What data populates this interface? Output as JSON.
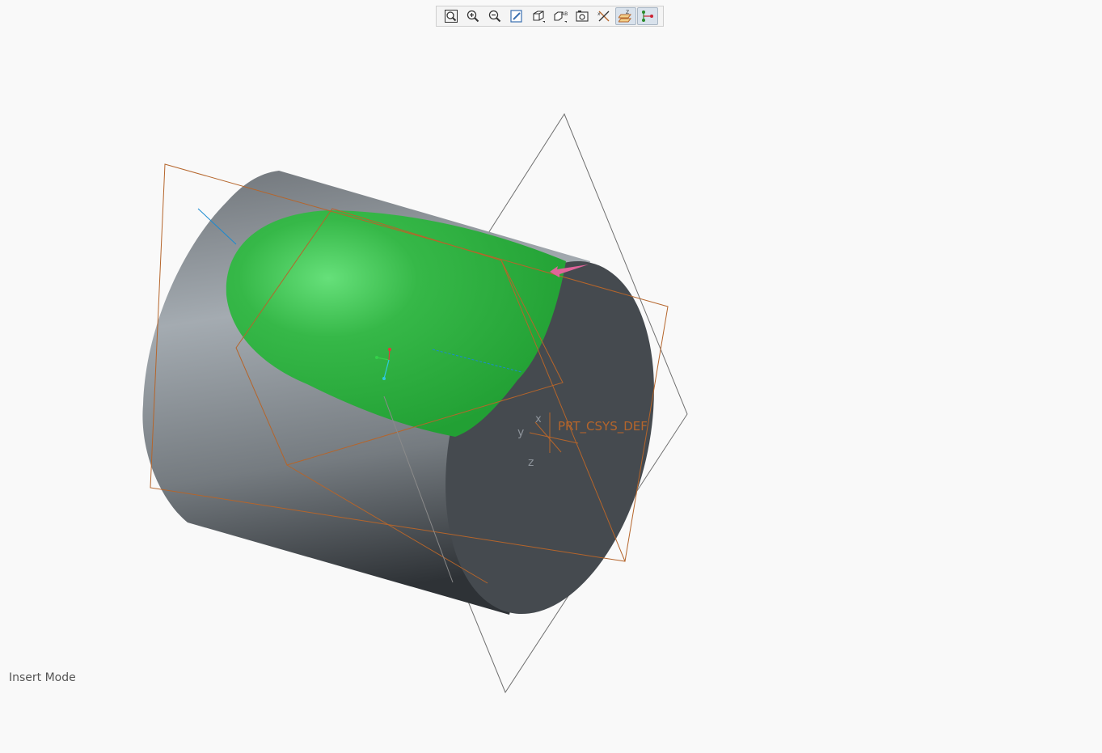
{
  "toolbar": {
    "items": [
      {
        "icon": "zoom-fit-icon",
        "label": "Refit",
        "active": false
      },
      {
        "icon": "zoom-in-icon",
        "label": "Zoom In",
        "active": false
      },
      {
        "icon": "zoom-out-icon",
        "label": "Zoom Out",
        "active": false
      },
      {
        "icon": "repaint-icon",
        "label": "Repaint",
        "active": false
      },
      {
        "icon": "display-style-icon",
        "label": "Display Style",
        "active": false
      },
      {
        "icon": "saved-orientations-icon",
        "label": "Saved Orientations",
        "active": false
      },
      {
        "icon": "view-manager-icon",
        "label": "View Manager",
        "active": false
      },
      {
        "icon": "perspective-icon",
        "label": "Perspective",
        "active": false
      },
      {
        "icon": "datum-display-icon",
        "label": "Datum Display Filters",
        "active": true
      },
      {
        "icon": "spin-center-icon",
        "label": "Spin Center",
        "active": true
      }
    ]
  },
  "viewport": {
    "csys_label": "PRT_CSYS_DEF",
    "axis_x": "x",
    "axis_y": "y",
    "axis_z": "z",
    "colors": {
      "highlight_surface": "#2db23e",
      "body": "#8f969c",
      "end_face": "#454a4f",
      "datum_plane": "#b5652b"
    }
  },
  "status": {
    "mode": "Insert Mode"
  }
}
